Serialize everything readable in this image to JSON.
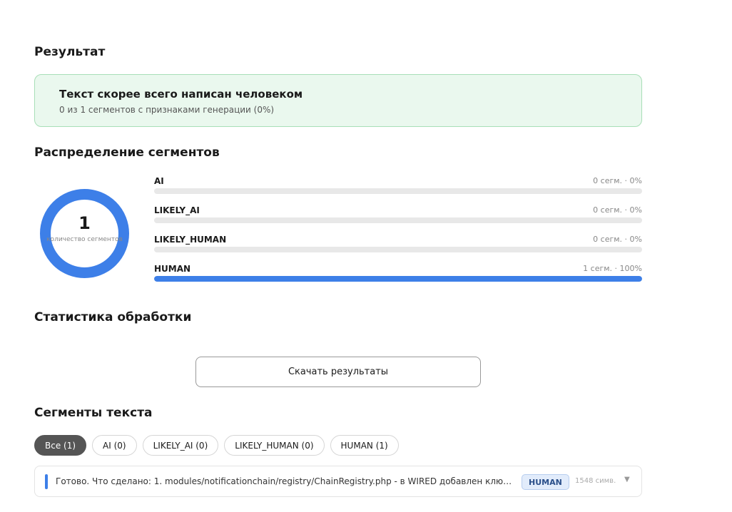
{
  "result": {
    "title": "Результат",
    "headline": "Текст скорее всего написан человеком",
    "summary": "0 из 1 сегментов с признаками генерации (0%)"
  },
  "distribution": {
    "title": "Распределение сегментов",
    "total": "1",
    "total_label": "количество сегментов",
    "accent_color": "#3d7fe8",
    "rows": [
      {
        "name": "AI",
        "count": "0 сегм. · 0%",
        "percent": 0
      },
      {
        "name": "LIKELY_AI",
        "count": "0 сегм. · 0%",
        "percent": 0
      },
      {
        "name": "LIKELY_HUMAN",
        "count": "0 сегм. · 0%",
        "percent": 0
      },
      {
        "name": "HUMAN",
        "count": "1 сегм. · 100%",
        "percent": 100
      }
    ]
  },
  "stats": {
    "title": "Статистика обработки",
    "download_label": "Скачать результаты"
  },
  "segments": {
    "title": "Сегменты текста",
    "filters": [
      {
        "label": "Все (1)",
        "active": true
      },
      {
        "label": "AI (0)",
        "active": false
      },
      {
        "label": "LIKELY_AI (0)",
        "active": false
      },
      {
        "label": "LIKELY_HUMAN (0)",
        "active": false
      },
      {
        "label": "HUMAN (1)",
        "active": false
      }
    ],
    "items": [
      {
        "text": "Готово. Что сделано: 1. modules/notificationchain/registry/ChainRegistry.php - в WIRED добавлен ключ...",
        "label": "HUMAN",
        "chars": "1548 симв.",
        "expand_icon": "chevron-down-icon"
      }
    ]
  }
}
